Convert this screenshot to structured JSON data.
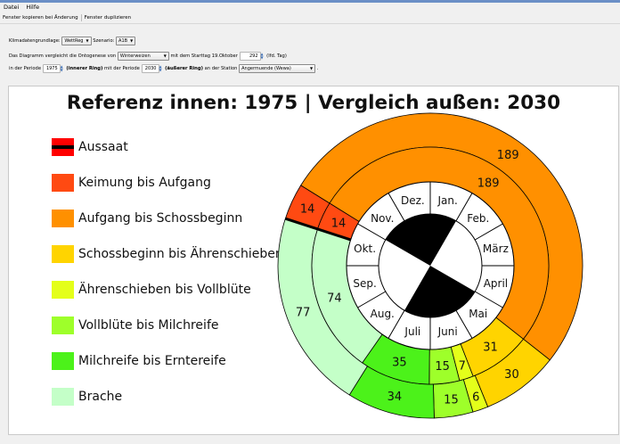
{
  "menu": {
    "datei": "Datei",
    "hilfe": "Hilfe"
  },
  "toolbar": {
    "copy_label": "Fenster kopieren bei Änderung",
    "duplicate_label": "Fenster duplizieren"
  },
  "settings": {
    "klima_label": "Klimadatengrundlage:",
    "klima_value": "WettReg",
    "szenario_label": "Szenario:",
    "szenario_value": "A1B",
    "row2_text1": "Das Diagramm vergleicht  die Ontogenese  von",
    "crop_value": "Winterweizen",
    "row2_text2": "mit dem Starttag  19.Oktober",
    "starttag_value": "292",
    "row2_text3": "(lfd. Tag)",
    "row3_text1": "in der Periode",
    "period_inner_value": "1975",
    "inner_label": "(innerer Ring)",
    "row3_text2": "mit der Periode",
    "period_outer_value": "2030",
    "outer_label": "(äußerer Ring)",
    "row3_text3": "an der Station",
    "station_value": "Angermuende (Wewa)",
    "row3_end": "."
  },
  "chart": {
    "title": "Referenz innen: 1975  |  Vergleich außen: 2030",
    "legend": [
      {
        "label": "Aussaat",
        "color": "#ff0000",
        "mark": "line"
      },
      {
        "label": "Keimung bis Aufgang",
        "color": "#ff4a12"
      },
      {
        "label": "Aufgang bis Schossbeginn",
        "color": "#ff9000"
      },
      {
        "label": "Schossbeginn bis Ährenschieben",
        "color": "#ffd400"
      },
      {
        "label": "Ährenschieben bis Vollblüte",
        "color": "#e4ff1a"
      },
      {
        "label": "Vollblüte bis Milchreife",
        "color": "#9eff2a"
      },
      {
        "label": "Milchreife bis Erntereife",
        "color": "#4cf21a"
      },
      {
        "label": "Brache",
        "color": "#c4ffc8"
      }
    ],
    "months": [
      "Jan.",
      "Feb.",
      "März",
      "April",
      "Mai",
      "Juni",
      "Juli",
      "Aug.",
      "Sep.",
      "Okt.",
      "Nov.",
      "Dez."
    ]
  },
  "chart_data": {
    "type": "pie",
    "title": "Referenz innen: 1975  |  Vergleich außen: 2030",
    "start_day": 292,
    "series": [
      {
        "name": "1975",
        "ring": "inner",
        "phases": [
          "Keimung bis Aufgang",
          "Aufgang bis Schossbeginn",
          "Schossbeginn bis Ährenschieben",
          "Ährenschieben bis Vollblüte",
          "Vollblüte bis Milchreife",
          "Milchreife bis Erntereife",
          "Brache"
        ],
        "values": [
          14,
          189,
          31,
          7,
          15,
          35,
          74
        ]
      },
      {
        "name": "2030",
        "ring": "outer",
        "phases": [
          "Keimung bis Aufgang",
          "Aufgang bis Schossbeginn",
          "Schossbeginn bis Ährenschieben",
          "Ährenschieben bis Vollblüte",
          "Vollblüte bis Milchreife",
          "Milchreife bis Erntereife",
          "Brache"
        ],
        "values": [
          14,
          189,
          30,
          6,
          15,
          34,
          77
        ]
      }
    ]
  }
}
